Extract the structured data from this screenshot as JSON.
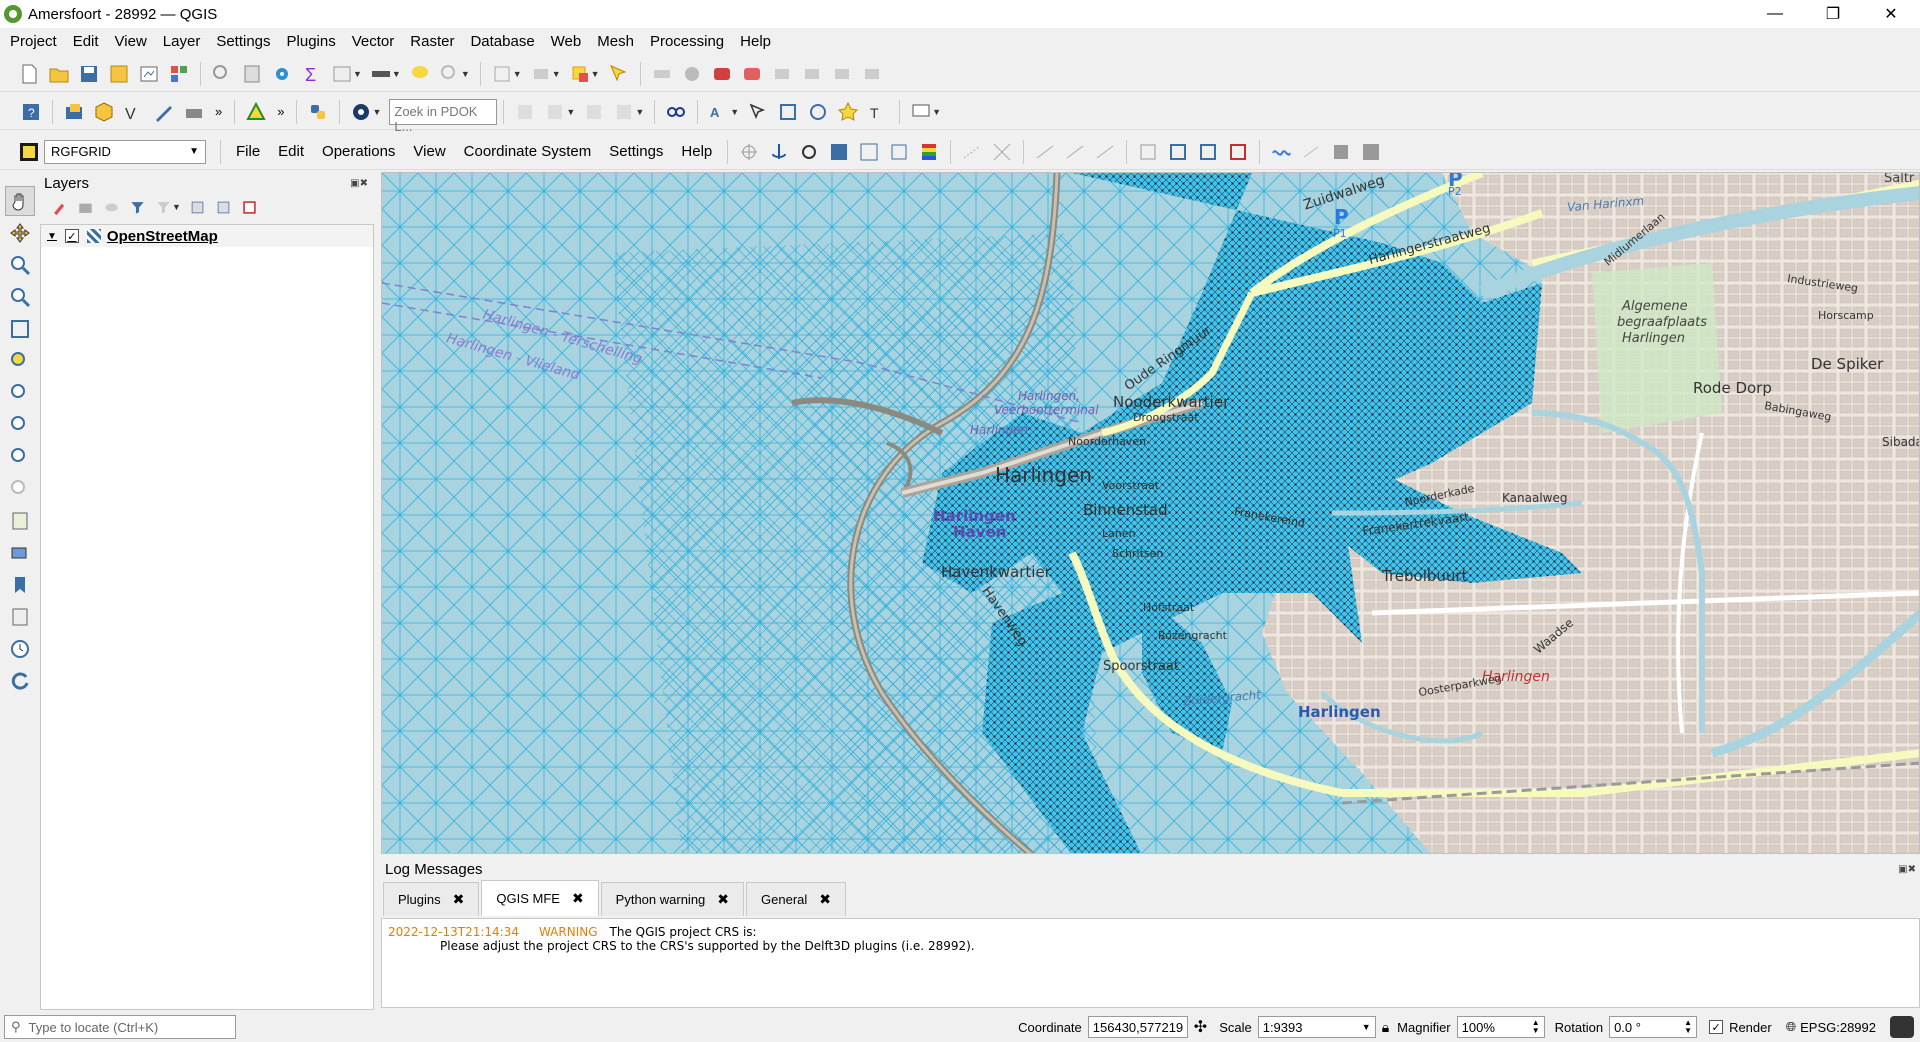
{
  "window": {
    "title": "Amersfoort - 28992 — QGIS",
    "minimize": "—",
    "maximize": "❐",
    "close": "✕"
  },
  "menu": [
    "Project",
    "Edit",
    "View",
    "Layer",
    "Settings",
    "Plugins",
    "Vector",
    "Raster",
    "Database",
    "Web",
    "Mesh",
    "Processing",
    "Help"
  ],
  "toolbar2": {
    "pdok_placeholder": "Zoek in PDOK L..."
  },
  "toolbar3": {
    "grid_combo": "RGFGRID",
    "menu": [
      "File",
      "Edit",
      "Operations",
      "View",
      "Coordinate System",
      "Settings",
      "Help"
    ]
  },
  "layers_panel": {
    "title": "Layers",
    "items": [
      {
        "name": "OpenStreetMap",
        "checked": true
      }
    ]
  },
  "map": {
    "labels": {
      "zuidwalweg": "Zuidwalweg",
      "harlingerstraatweg": "Harlingerstraatweg",
      "van_harinxma": "Van Harinxm",
      "p1": "P",
      "p1_sub": "P1",
      "p2": "P",
      "p2_sub": "P2",
      "saltr": "Saltr",
      "midlumerlaan": "Midlumerlaan",
      "industrieweg": "Industrieweg",
      "horscamp": "Horscamp",
      "algemene": "Algemene",
      "begraafplaats": "begraafplaats",
      "harlingen_bp": "Harlingen",
      "de_spiker": "De Spiker",
      "rode_dorp": "Rode Dorp",
      "babingaweg": "Babingaweg",
      "sibada": "Sibada",
      "oude_ringmuur": "Oude Ringmuur",
      "nooderkwartier": "Nooderkwartier",
      "droogstraat": "Droogstraat",
      "noorderhaven": "Noorderhaven",
      "harlingen_vt1": "Harlingen,",
      "harlingen_vt2": "Veerbootterminal",
      "harlingen_small": "Harlingen",
      "harlingen_main": "Harlingen",
      "voorstraat": "Voorstraat",
      "binnenstad": "Binnenstad",
      "lanen": "Lanen",
      "schritsen": "Schritsen",
      "franekereind": "Franekereind",
      "franekertrekvaart": "Franekertrekvaart",
      "noorderkade": "Noorderkade",
      "kanaalweg": "Kanaalweg",
      "trebolbuurt": "Trebolbuurt",
      "harlingen_haven1": "Harlingen",
      "harlingen_haven2": "Haven",
      "havenkwartier": "Havenkwartier",
      "havenweg": "Havenweg",
      "hofstraat": "Hofstraat",
      "rozengracht": "Rozengracht",
      "spoorstraat": "Spoorstraat",
      "zuidergracht": "Zuidergracht",
      "harlingen_station": "Harlingen",
      "harlingen_red": "Harlingen",
      "ferry1": "Harlingen - Terschelling",
      "ferry2": "Harlingen - Vlieland",
      "waadse": "Waadse",
      "oosterparkweg": "Oosterparkweg"
    }
  },
  "log_panel": {
    "title": "Log Messages",
    "tabs": [
      {
        "label": "Plugins",
        "active": false
      },
      {
        "label": "QGIS MFE",
        "active": true
      },
      {
        "label": "Python warning",
        "active": false
      },
      {
        "label": "General",
        "active": false
      }
    ],
    "close_glyph": "✖",
    "entry": {
      "timestamp": "2022-12-13T21:14:34",
      "level": "WARNING",
      "line1": "The QGIS project CRS is:",
      "line2": "Please adjust the project CRS to the CRS's supported by the Delft3D plugins (i.e. 28992)."
    }
  },
  "status": {
    "locate_placeholder": "Type to locate (Ctrl+K)",
    "coordinate_label": "Coordinate",
    "coordinate_value": "156430,577219",
    "scale_label": "Scale",
    "scale_value": "1:9393",
    "magnifier_label": "Magnifier",
    "magnifier_value": "100%",
    "rotation_label": "Rotation",
    "rotation_value": "0.0 °",
    "render_label": "Render",
    "render_checked": true,
    "crs": "EPSG:28992"
  },
  "colors": {
    "water": "#a9d3df",
    "mesh_fine": "#4fc6e8",
    "land": "#f2efe9",
    "buildings": "#d9d0c9",
    "roads_major": "#f7fabf",
    "qgis_green": "#589632",
    "warning": "#e67e00"
  }
}
